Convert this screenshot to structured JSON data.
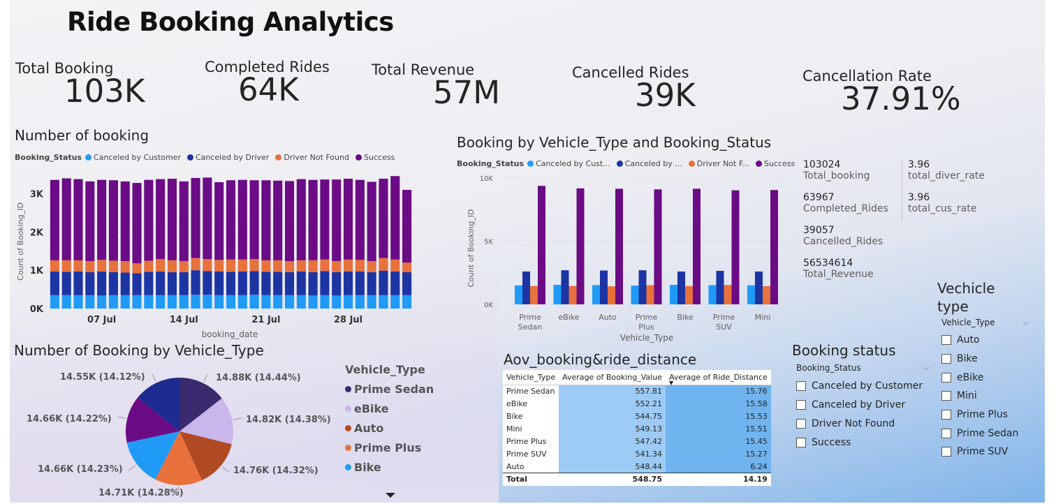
{
  "title": "Ride Booking Analytics",
  "kpis": [
    {
      "label": "Total Booking",
      "value": "103K"
    },
    {
      "label": "Completed Rides",
      "value": "64K"
    },
    {
      "label": "Total Revenue",
      "value": "57M"
    },
    {
      "label": "Cancelled Rides",
      "value": "39K"
    },
    {
      "label": "Cancellation Rate",
      "value": "37.91%"
    }
  ],
  "status_colors": {
    "Canceled by Customer": "#1f9bf7",
    "Canceled by Driver": "#1d34a3",
    "Driver Not Found": "#e8713c",
    "Success": "#6b0b85"
  },
  "booking_chart": {
    "title": "Number of booking",
    "legend_title": "Booking_Status",
    "legend_items": [
      "Canceled by Customer",
      "Canceled by Driver",
      "Driver Not Found",
      "Success"
    ],
    "xlabel": "booking_date",
    "ylabel": "Count of Booking_ID"
  },
  "vehicle_chart": {
    "title": "Booking by Vehicle_Type and Booking_Status",
    "legend_title": "Booking_Status",
    "legend_items": [
      "Canceled by Cust...",
      "Canceled by ...",
      "Driver Not F...",
      "Success"
    ],
    "xlabel": "Vehicle_Type",
    "ylabel": "Count of Booking_ID"
  },
  "card": {
    "left": [
      {
        "value": "103024",
        "label": "Total_booking"
      },
      {
        "value": "63967",
        "label": "Completed_Rides"
      },
      {
        "value": "39057",
        "label": "Cancelled_Rides"
      },
      {
        "value": "56534614",
        "label": "Total_Revenue"
      }
    ],
    "right": [
      {
        "value": "3.96",
        "label": "total_diver_rate"
      },
      {
        "value": "3.96",
        "label": "total_cus_rate"
      }
    ]
  },
  "pie_chart": {
    "title": "Number of Booking by Vehicle_Type",
    "legend_title": "Vehicle_Type",
    "legend_items": [
      {
        "name": "Prime Sedan",
        "color": "#3b2b6e"
      },
      {
        "name": "eBike",
        "color": "#c9b6ea"
      },
      {
        "name": "Auto",
        "color": "#b04a22"
      },
      {
        "name": "Prime Plus",
        "color": "#e8713c"
      },
      {
        "name": "Bike",
        "color": "#1f9bf7"
      }
    ]
  },
  "aov_table": {
    "title": "Aov_booking&ride_distance",
    "headers": [
      "Vehicle_Type",
      "Average of Booking_Value",
      "Average of Ride_Distance"
    ],
    "rows": [
      [
        "Prime Sedan",
        "557.81",
        "15.76"
      ],
      [
        "eBike",
        "552.21",
        "15.58"
      ],
      [
        "Bike",
        "544.75",
        "15.53"
      ],
      [
        "Mini",
        "549.13",
        "15.51"
      ],
      [
        "Prime Plus",
        "547.42",
        "15.45"
      ],
      [
        "Prime SUV",
        "541.34",
        "15.27"
      ],
      [
        "Auto",
        "548.44",
        "6.24"
      ]
    ],
    "total": [
      "Total",
      "548.75",
      "14.19"
    ]
  },
  "booking_status_slicer": {
    "title": "Booking status",
    "header": "Booking_Status",
    "options": [
      "Canceled by Customer",
      "Canceled by Driver",
      "Driver Not Found",
      "Success"
    ]
  },
  "vehicle_slicer": {
    "title_line1": "Vechicle",
    "title_line2": "type",
    "header": "Vehicle_Type",
    "options": [
      "Auto",
      "Bike",
      "eBike",
      "Mini",
      "Prime Plus",
      "Prime Sedan",
      "Prime SUV"
    ]
  },
  "chart_data": [
    {
      "type": "bar",
      "title": "Number of booking",
      "xlabel": "booking_date",
      "ylabel": "Count of Booking_ID",
      "stacked": true,
      "ylim": [
        0,
        3500
      ],
      "yticks": [
        "0K",
        "1K",
        "2K",
        "3K"
      ],
      "ytick_values": [
        0,
        1000,
        2000,
        3000
      ],
      "xtick_labels": [
        {
          "index": 4,
          "label": "07 Jul"
        },
        {
          "index": 11,
          "label": "14 Jul"
        },
        {
          "index": 18,
          "label": "21 Jul"
        },
        {
          "index": 25,
          "label": "28 Jul"
        }
      ],
      "series": [
        {
          "name": "Canceled by Customer",
          "values": [
            350,
            350,
            350,
            350,
            340,
            350,
            350,
            350,
            350,
            350,
            350,
            350,
            360,
            360,
            350,
            350,
            350,
            360,
            350,
            350,
            350,
            350,
            340,
            350,
            340,
            350,
            350,
            350,
            350,
            350,
            350
          ]
        },
        {
          "name": "Canceled by Driver",
          "values": [
            620,
            610,
            620,
            600,
            630,
            600,
            590,
            570,
            610,
            620,
            600,
            600,
            640,
            620,
            620,
            610,
            620,
            620,
            610,
            610,
            600,
            620,
            610,
            630,
            610,
            620,
            620,
            600,
            640,
            620,
            600
          ]
        },
        {
          "name": "Driver Not Found",
          "values": [
            290,
            300,
            290,
            290,
            300,
            300,
            300,
            260,
            290,
            320,
            310,
            290,
            320,
            310,
            300,
            320,
            310,
            310,
            300,
            300,
            290,
            290,
            310,
            300,
            290,
            310,
            300,
            290,
            330,
            310,
            250
          ]
        },
        {
          "name": "Success",
          "values": [
            2100,
            2140,
            2120,
            2080,
            2090,
            2100,
            2080,
            2100,
            2110,
            2090,
            2130,
            2080,
            2090,
            2130,
            2030,
            2070,
            2080,
            2060,
            2090,
            2080,
            2090,
            2120,
            2100,
            2090,
            2130,
            2110,
            2090,
            2070,
            2070,
            2180,
            1900
          ]
        }
      ]
    },
    {
      "type": "bar",
      "title": "Booking by Vehicle_Type and Booking_Status",
      "xlabel": "Vehicle_Type",
      "ylabel": "Count of Booking_ID",
      "ylim": [
        0,
        10000
      ],
      "yticks": [
        "0K",
        "5K",
        "10K"
      ],
      "ytick_values": [
        0,
        5000,
        10000
      ],
      "categories": [
        "Prime Sedan",
        "eBike",
        "Auto",
        "Prime Plus",
        "Bike",
        "Prime SUV",
        "Mini"
      ],
      "series": [
        {
          "name": "Canceled by Customer",
          "values": [
            1500,
            1550,
            1520,
            1480,
            1540,
            1520,
            1510
          ]
        },
        {
          "name": "Canceled by Driver",
          "values": [
            2600,
            2700,
            2680,
            2700,
            2600,
            2650,
            2600
          ]
        },
        {
          "name": "Driver Not Found",
          "values": [
            1450,
            1450,
            1430,
            1520,
            1450,
            1530,
            1440
          ]
        },
        {
          "name": "Success",
          "values": [
            9380,
            9180,
            9150,
            9100,
            9150,
            9030,
            9050
          ]
        }
      ]
    },
    {
      "type": "pie",
      "title": "Number of Booking by Vehicle_Type",
      "categories": [
        "Prime Sedan",
        "eBike",
        "Auto",
        "Prime Plus",
        "Bike",
        "Mini",
        "Prime SUV"
      ],
      "values": [
        14.88,
        14.82,
        14.76,
        14.71,
        14.66,
        14.66,
        14.55
      ],
      "labels": [
        "14.88K (14.44%)",
        "14.82K (14.38%)",
        "14.76K (14.32%)",
        "14.71K (14.28%)",
        "14.66K (14.23%)",
        "14.66K (14.22%)",
        "14.55K (14.12%)"
      ],
      "colors": [
        "#3b2b6e",
        "#c9b6ea",
        "#b04a22",
        "#e8713c",
        "#1f9bf7",
        "#6b0b85",
        "#1d2a8f"
      ]
    }
  ]
}
